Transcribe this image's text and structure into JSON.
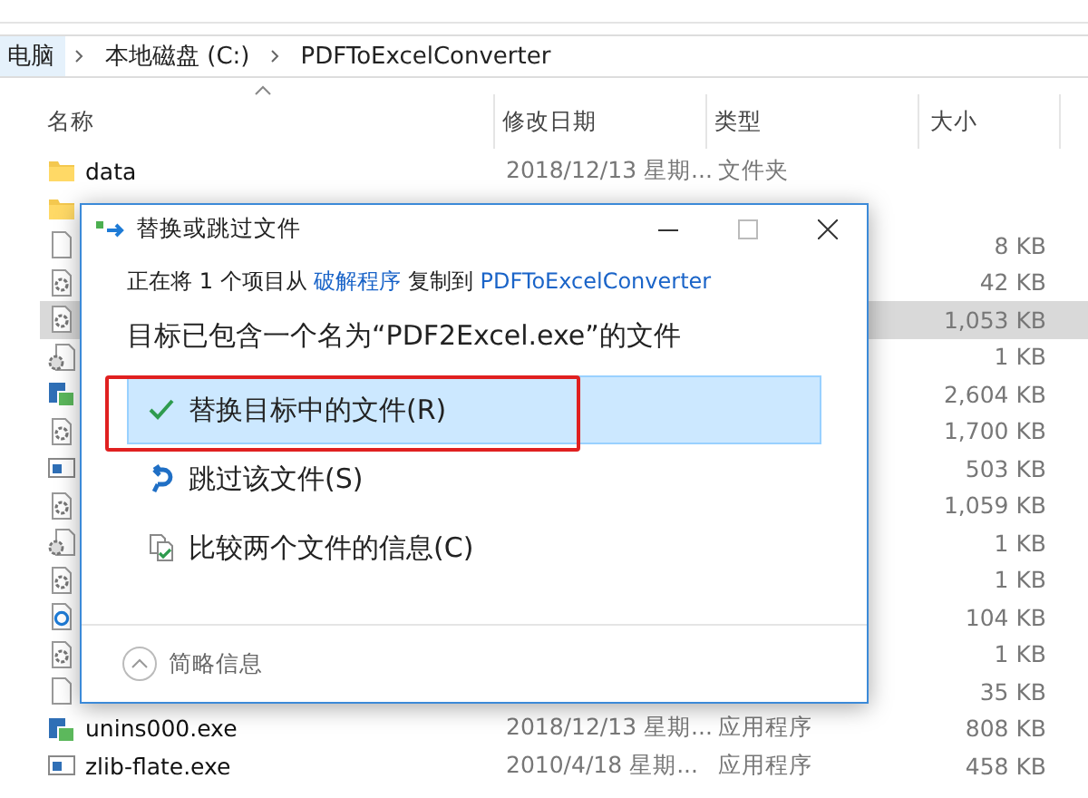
{
  "breadcrumb": [
    {
      "label": "电脑",
      "selected": true
    },
    {
      "label": "本地磁盘 (C:)",
      "selected": false
    },
    {
      "label": "PDFToExcelConverter",
      "selected": false
    }
  ],
  "table": {
    "columns": [
      "名称",
      "修改日期",
      "类型",
      "大小"
    ],
    "rows": [
      {
        "kind": "folder",
        "name": "data",
        "date": "2018/12/13 星期...",
        "type": "文件夹",
        "selected": false
      },
      {
        "kind": "folder",
        "selected": false
      },
      {
        "kind": "blank",
        "size": "8 KB",
        "selected": false
      },
      {
        "kind": "gear-doc",
        "size": "42 KB",
        "selected": false
      },
      {
        "kind": "gear-doc",
        "size": "1,053 KB",
        "selected": true
      },
      {
        "kind": "gear",
        "size": "1 KB",
        "selected": false
      },
      {
        "kind": "app",
        "size": "2,604 KB",
        "selected": false
      },
      {
        "kind": "gear-doc",
        "size": "1,700 KB",
        "selected": false
      },
      {
        "kind": "window",
        "size": "503 KB",
        "selected": false
      },
      {
        "kind": "gear-doc",
        "size": "1,059 KB",
        "selected": false
      },
      {
        "kind": "gear",
        "size": "1 KB",
        "selected": false
      },
      {
        "kind": "gear-doc",
        "size": "1 KB",
        "selected": false
      },
      {
        "kind": "target",
        "size": "104 KB",
        "selected": false
      },
      {
        "kind": "gear-doc",
        "size": "1 KB",
        "selected": false
      },
      {
        "kind": "blank",
        "size": "35 KB",
        "selected": false
      },
      {
        "kind": "app",
        "name": "unins000.exe",
        "date": "2018/12/13 星期...",
        "type": "应用程序",
        "size": "808 KB",
        "selected": false
      },
      {
        "kind": "window",
        "name": "zlib-flate.exe",
        "date": "2010/4/18 星期...",
        "type": "应用程序",
        "size": "458 KB",
        "selected": false
      }
    ]
  },
  "dialog": {
    "title": "替换或跳过文件",
    "copy_line": {
      "prefix": "正在将 1 个项目从",
      "source": "破解程序",
      "middle": "复制到",
      "target": "PDFToExcelConverter"
    },
    "heading": "目标已包含一个名为“PDF2Excel.exe”的文件",
    "options": [
      {
        "kind": "replace",
        "label": "替换目标中的文件(R)",
        "selected": true,
        "highlighted": true
      },
      {
        "kind": "skip",
        "label": "跳过该文件(S)",
        "selected": false,
        "highlighted": false
      },
      {
        "kind": "compare",
        "label": "比较两个文件的信息(C)",
        "selected": false,
        "highlighted": false
      }
    ],
    "footer": "简略信息"
  }
}
